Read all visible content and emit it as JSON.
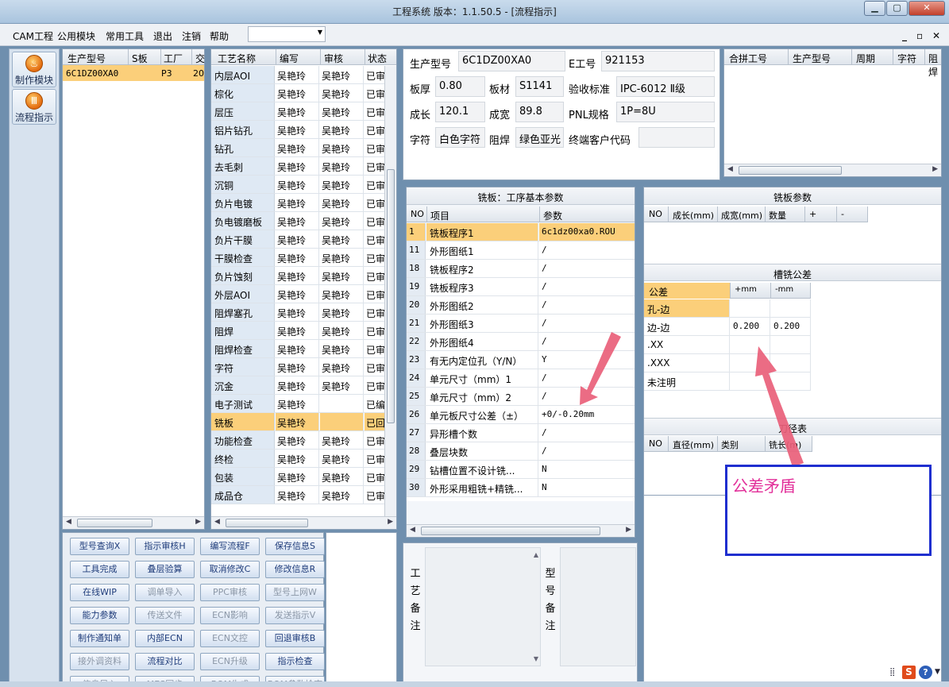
{
  "window": {
    "title": "工程系统   版本：1.1.50.5 - [流程指示]"
  },
  "menu": {
    "items": [
      "CAM工程",
      "公用模块",
      "常用工具",
      "退出",
      "注销",
      "帮助"
    ],
    "combo_value": ""
  },
  "sidebar": {
    "buttons": [
      "制作模块",
      "流程指示"
    ]
  },
  "models_table": {
    "headers": [
      "生产型号",
      "S板",
      "工厂",
      "交"
    ],
    "rows": [
      [
        "6C1DZ00XA0",
        "",
        "P3",
        "20"
      ]
    ]
  },
  "process_table": {
    "headers": [
      "工艺名称",
      "编写",
      "审核",
      "状态"
    ],
    "rows": [
      [
        "内层AOI",
        "吴艳玲",
        "吴艳玲",
        "已审"
      ],
      [
        "棕化",
        "吴艳玲",
        "吴艳玲",
        "已审"
      ],
      [
        "层压",
        "吴艳玲",
        "吴艳玲",
        "已审"
      ],
      [
        "铝片钻孔",
        "吴艳玲",
        "吴艳玲",
        "已审"
      ],
      [
        "钻孔",
        "吴艳玲",
        "吴艳玲",
        "已审"
      ],
      [
        "去毛刺",
        "吴艳玲",
        "吴艳玲",
        "已审"
      ],
      [
        "沉铜",
        "吴艳玲",
        "吴艳玲",
        "已审"
      ],
      [
        "负片电镀",
        "吴艳玲",
        "吴艳玲",
        "已审"
      ],
      [
        "负电镀磨板",
        "吴艳玲",
        "吴艳玲",
        "已审"
      ],
      [
        "负片干膜",
        "吴艳玲",
        "吴艳玲",
        "已审"
      ],
      [
        "干膜检查",
        "吴艳玲",
        "吴艳玲",
        "已审"
      ],
      [
        "负片蚀刻",
        "吴艳玲",
        "吴艳玲",
        "已审"
      ],
      [
        "外层AOI",
        "吴艳玲",
        "吴艳玲",
        "已审"
      ],
      [
        "阻焊塞孔",
        "吴艳玲",
        "吴艳玲",
        "已审"
      ],
      [
        "阻焊",
        "吴艳玲",
        "吴艳玲",
        "已审"
      ],
      [
        "阻焊检查",
        "吴艳玲",
        "吴艳玲",
        "已审"
      ],
      [
        "字符",
        "吴艳玲",
        "吴艳玲",
        "已审"
      ],
      [
        "沉金",
        "吴艳玲",
        "吴艳玲",
        "已审"
      ],
      [
        "电子测试",
        "吴艳玲",
        "",
        "已编"
      ],
      [
        "铣板",
        "吴艳玲",
        "",
        "已回"
      ],
      [
        "功能检查",
        "吴艳玲",
        "吴艳玲",
        "已审"
      ],
      [
        "终检",
        "吴艳玲",
        "吴艳玲",
        "已审"
      ],
      [
        "包装",
        "吴艳玲",
        "吴艳玲",
        "已审"
      ],
      [
        "成品仓",
        "吴艳玲",
        "吴艳玲",
        "已审"
      ]
    ],
    "selected_index": 19
  },
  "action_buttons": [
    [
      "型号查询X",
      "指示审核H",
      "编写流程F",
      "保存信息S"
    ],
    [
      "工具完成",
      "叠层验算",
      "取消修改C",
      "修改信息R"
    ],
    [
      "在线WIP",
      "调单导入",
      "PPC审核",
      "型号上网W"
    ],
    [
      "能力参数",
      "传送文件",
      "ECN影响",
      "发送指示V"
    ],
    [
      "制作通知单",
      "内部ECN",
      "ECN文控",
      "回退审核B"
    ],
    [
      "接外调资料",
      "流程对比",
      "ECN升级",
      "指示检查"
    ],
    [
      "信息导入",
      "MES同步",
      "BOM生成",
      "BOM参数检查"
    ]
  ],
  "disabled_buttons": [
    "调单导入",
    "PPC审核",
    "型号上网W",
    "传送文件",
    "ECN影响",
    "发送指示V",
    "ECN文控",
    "接外调资料",
    "ECN升级",
    "MES同步",
    "BOM生成",
    "BOM参数检查",
    "信息导入"
  ],
  "info": {
    "labels": {
      "model": "生产型号",
      "e_no": "E工号",
      "thickness": "板厚",
      "material": "板材",
      "standard": "验收标准",
      "length": "成长",
      "width": "成宽",
      "pnl": "PNL规格",
      "legend": "字符",
      "mask": "阻焊",
      "customer": "终端客户代码"
    },
    "values": {
      "model": "6C1DZ00XA0",
      "e_no": "921153",
      "thickness": "0.80",
      "material": "S1141",
      "standard": "IPC-6012 Ⅱ级",
      "length": "120.1",
      "width": "89.8",
      "pnl": "1P=8U",
      "legend": "白色字符",
      "mask": "绿色亚光",
      "customer": ""
    }
  },
  "merge_table": {
    "headers": [
      "合拼工号",
      "生产型号",
      "周期",
      "字符",
      "阻焊"
    ]
  },
  "params_panel": {
    "title": "铣板：工序基本参数",
    "headers": [
      "NO",
      "项目",
      "参数"
    ],
    "rows": [
      [
        "1",
        "铣板程序1",
        "6c1dz00xa0.ROU"
      ],
      [
        "11",
        "外形图纸1",
        "/"
      ],
      [
        "18",
        "铣板程序2",
        "/"
      ],
      [
        "19",
        "铣板程序3",
        "/"
      ],
      [
        "20",
        "外形图纸2",
        "/"
      ],
      [
        "21",
        "外形图纸3",
        "/"
      ],
      [
        "22",
        "外形图纸4",
        "/"
      ],
      [
        "23",
        "有无内定位孔（Y/N）",
        "Y"
      ],
      [
        "24",
        "单元尺寸（mm）1",
        "/"
      ],
      [
        "25",
        "单元尺寸（mm）2",
        "/"
      ],
      [
        "26",
        "单元板尺寸公差（±）",
        "+0/-0.20mm"
      ],
      [
        "27",
        "异形槽个数",
        "/"
      ],
      [
        "28",
        "叠层块数",
        "/"
      ],
      [
        "29",
        "钻槽位置不设计铣...",
        "N"
      ],
      [
        "30",
        "外形采用粗铣+精铣...",
        "N"
      ]
    ]
  },
  "remarks": {
    "process": "工艺备注",
    "model": "型号备注"
  },
  "mill_params": {
    "title": "铣板参数",
    "headers": [
      "NO",
      "成长(mm)",
      "成宽(mm)",
      "数量",
      "+",
      "-"
    ]
  },
  "tolerance": {
    "title": "槽铣公差",
    "headers": [
      "公差",
      "+mm",
      "-mm"
    ],
    "rows": [
      [
        "孔-边",
        "",
        ""
      ],
      [
        "边-边",
        "0.200",
        "0.200"
      ],
      [
        ".XX",
        "",
        ""
      ],
      [
        ".XXX",
        "",
        ""
      ],
      [
        "未注明",
        "",
        ""
      ]
    ]
  },
  "tool_table": {
    "title": "刀径表",
    "headers": [
      "NO",
      "直径(mm)",
      "类别",
      "铣长(m)"
    ]
  },
  "annotation": {
    "text": "公差矛盾",
    "arrow_color": "#e9607a",
    "box_border": "#1f2fcf",
    "text_color": "#e2309a"
  },
  "colors": {
    "selection": "#fbcf7a",
    "chrome": "#6f8fae"
  }
}
